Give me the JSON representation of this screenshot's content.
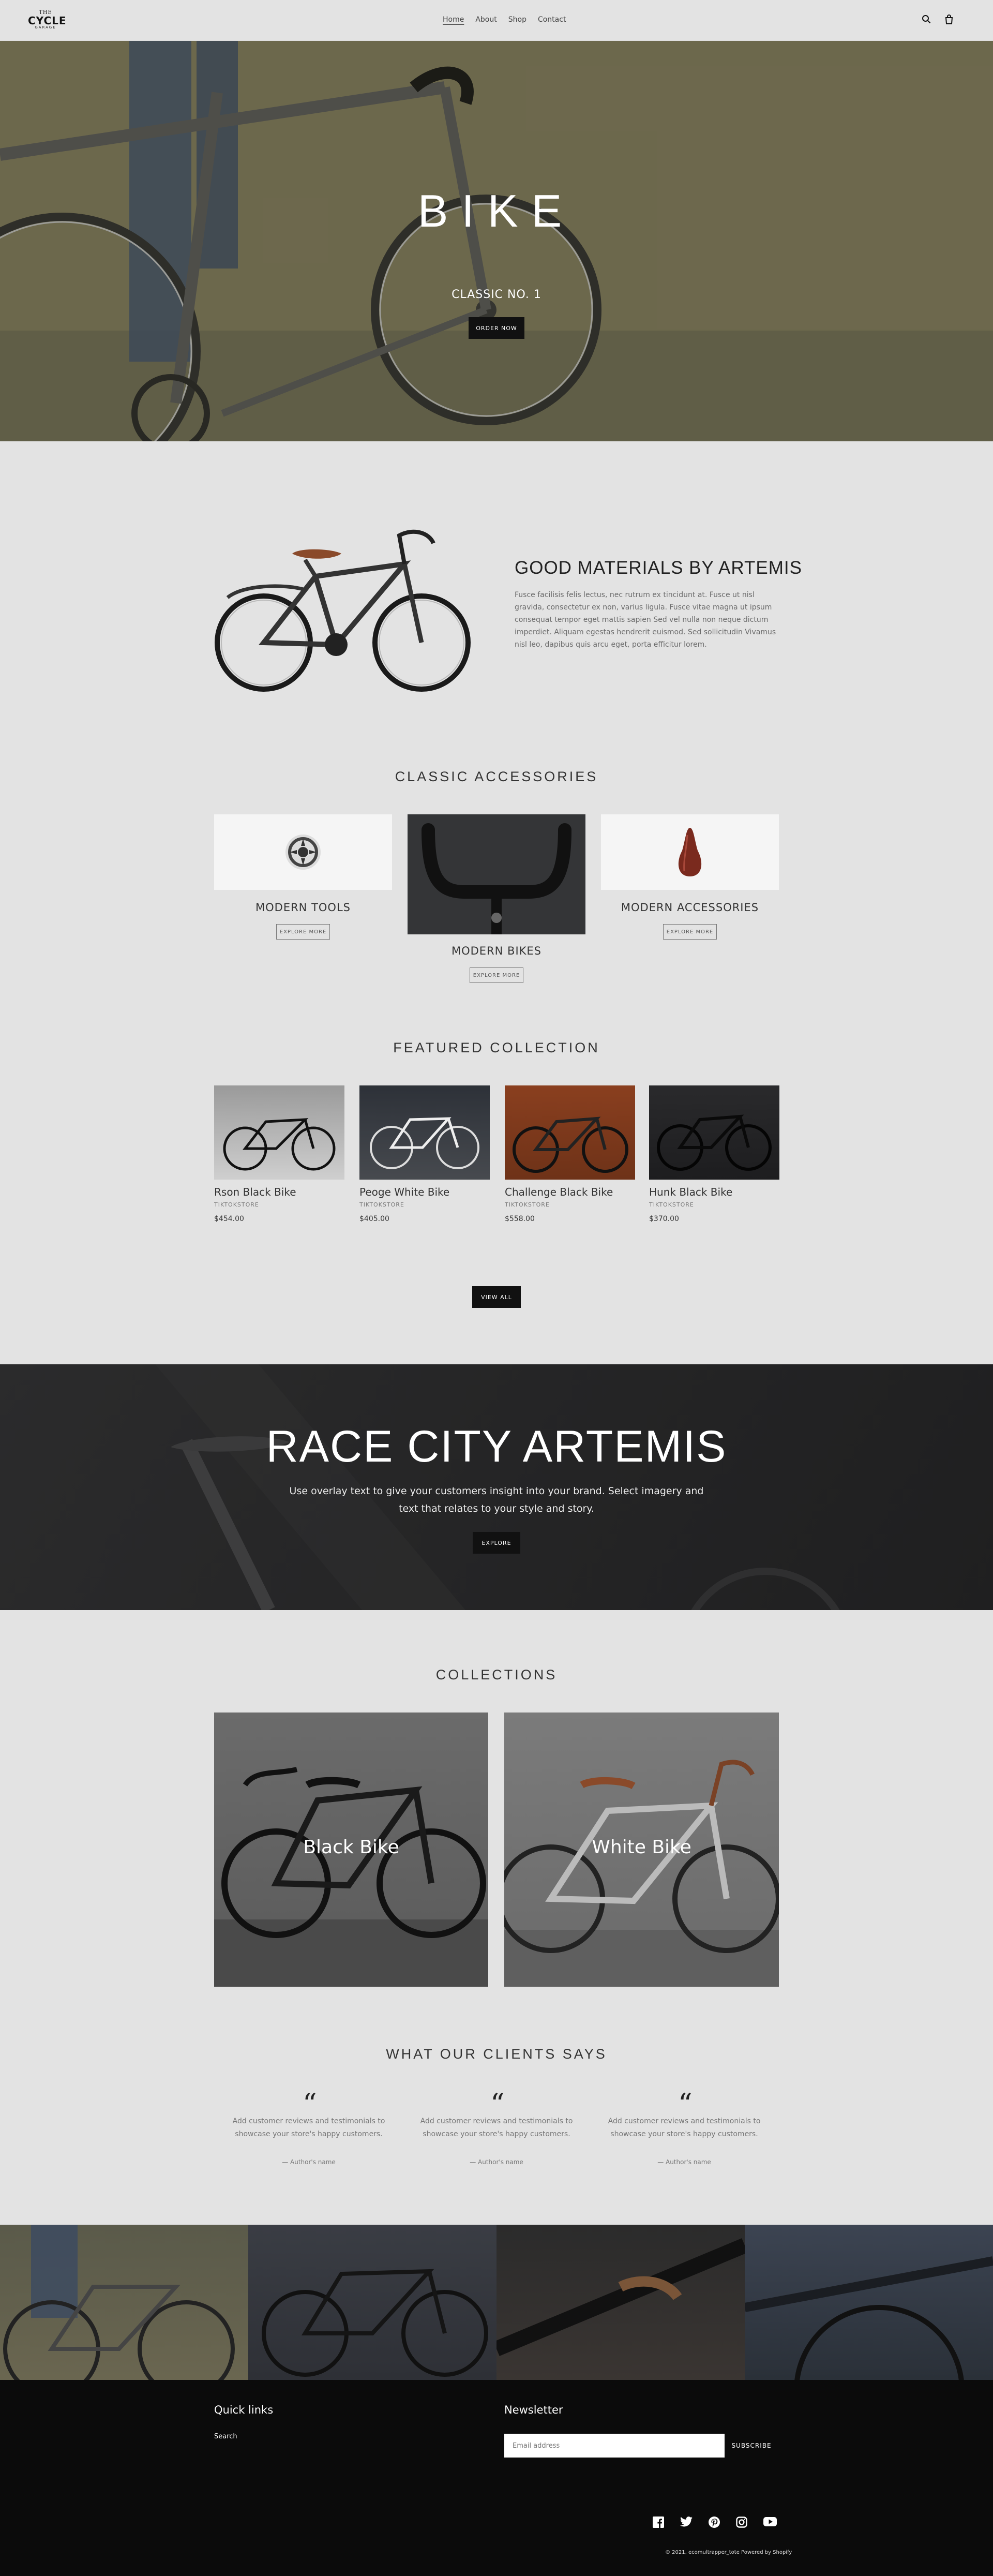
{
  "header": {
    "logo_top": "THE",
    "logo_main": "CYCLE",
    "logo_bottom": "GARAGE",
    "nav": [
      "Home",
      "About",
      "Shop",
      "Contact"
    ]
  },
  "hero": {
    "title": "BIKE",
    "subtitle": "CLASSIC NO. 1",
    "button": "ORDER NOW"
  },
  "materials": {
    "title": "GOOD MATERIALS BY ARTEMIS",
    "text": "Fusce facilisis felis lectus, nec rutrum ex tincidunt at. Fusce ut nisl gravida, consectetur ex non, varius ligula. Fusce vitae magna ut ipsum consequat tempor eget mattis sapien Sed vel nulla non neque dictum imperdiet. Aliquam egestas hendrerit euismod. Sed sollicitudin Vivamus nisl leo, dapibus quis arcu eget, porta efficitur lorem."
  },
  "accessories": {
    "title": "CLASSIC ACCESSORIES",
    "items": [
      {
        "label": "MODERN TOOLS",
        "button": "EXPLORE MORE"
      },
      {
        "label": "MODERN BIKES",
        "button": "EXPLORE MORE"
      },
      {
        "label": "MODERN ACCESSORIES",
        "button": "EXPLORE MORE"
      }
    ]
  },
  "featured": {
    "title": "FEATURED COLLECTION",
    "products": [
      {
        "name": "Rson Black Bike",
        "vendor": "TIKTOKSTORE",
        "price": "$454.00"
      },
      {
        "name": "Peoge White Bike",
        "vendor": "TIKTOKSTORE",
        "price": "$405.00"
      },
      {
        "name": "Challenge Black Bike",
        "vendor": "TIKTOKSTORE",
        "price": "$558.00"
      },
      {
        "name": "Hunk Black Bike",
        "vendor": "TIKTOKSTORE",
        "price": "$370.00"
      }
    ],
    "view_all": "VIEW ALL"
  },
  "race": {
    "title": "RACE CITY ARTEMIS",
    "text": "Use overlay text to give your customers insight into your brand. Select imagery and text that relates to your style and story.",
    "button": "EXPLORE"
  },
  "collections": {
    "title": "COLLECTIONS",
    "items": [
      "Black Bike",
      "White Bike"
    ]
  },
  "testimonials": {
    "title": "WHAT OUR CLIENTS SAYS",
    "items": [
      {
        "text": "Add customer reviews and testimonials to showcase your store's happy customers.",
        "author": "— Author's name"
      },
      {
        "text": "Add customer reviews and testimonials to showcase your store's happy customers.",
        "author": "— Author's name"
      },
      {
        "text": "Add customer reviews and testimonials to showcase your store's happy customers.",
        "author": "— Author's name"
      }
    ]
  },
  "footer": {
    "quick_links_title": "Quick links",
    "search": "Search",
    "newsletter_title": "Newsletter",
    "email_placeholder": "Email address",
    "subscribe": "SUBSCRIBE",
    "copyright": "© 2021, ecomultrapper_tote Powered by Shopify"
  }
}
